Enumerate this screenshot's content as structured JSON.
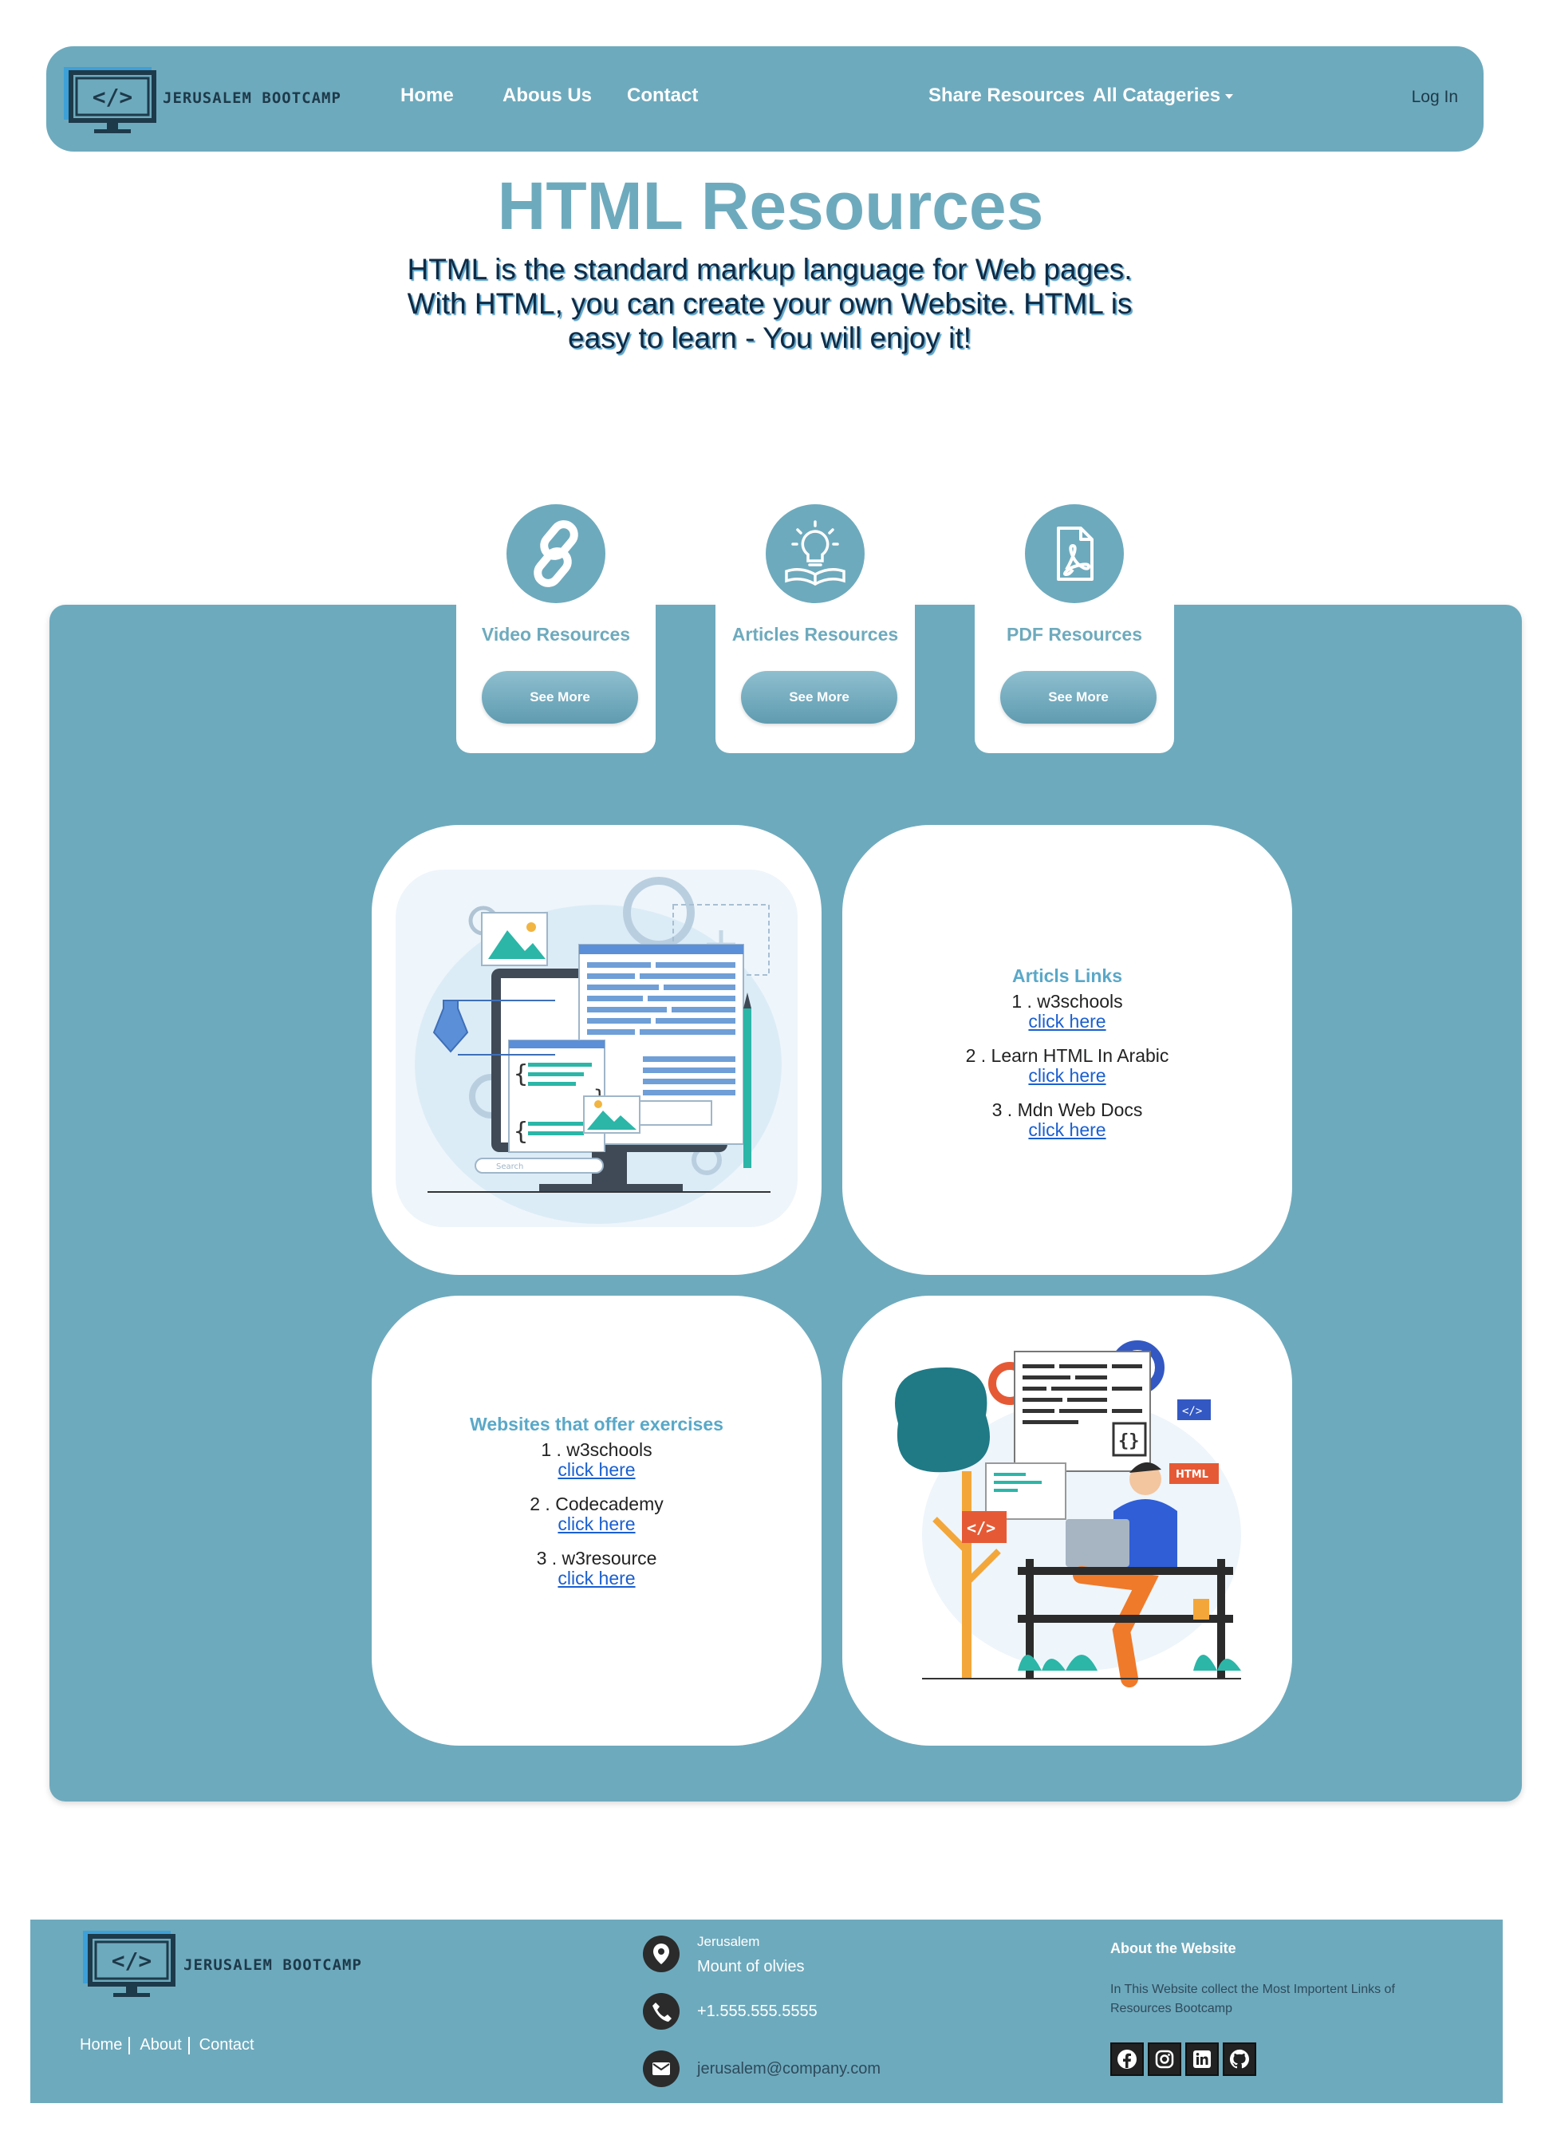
{
  "nav": {
    "brand": "JERUSALEM BOOTCAMP",
    "links": [
      "Home",
      "Abous Us",
      "Contact"
    ],
    "share": "Share Resources",
    "categories": "All Catageries",
    "login": "Log In"
  },
  "hero": {
    "title": "HTML Resources",
    "subtitle": "HTML is the standard markup language for Web pages. With HTML, you can create your own Website. HTML is easy to learn - You will enjoy it!"
  },
  "categories": [
    {
      "title": "Video Resources",
      "button": "See More",
      "icon": "link-icon"
    },
    {
      "title": "Articles Resources",
      "button": "See More",
      "icon": "lightbulb-book-icon"
    },
    {
      "title": "PDF Resources",
      "button": "See More",
      "icon": "pdf-file-icon"
    }
  ],
  "articles": {
    "title": "Articls Links",
    "items": [
      {
        "label": "1 . w3schools",
        "link": "click here"
      },
      {
        "label": "2 . Learn HTML In Arabic",
        "link": "click here"
      },
      {
        "label": "3 . Mdn Web Docs",
        "link": "click here"
      }
    ]
  },
  "exercises": {
    "title": "Websites that offer exercises",
    "items": [
      {
        "label": "1 . w3schools",
        "link": "click here"
      },
      {
        "label": "2 . Codecademy",
        "link": "click here"
      },
      {
        "label": "3 . w3resource",
        "link": "click here"
      }
    ]
  },
  "footer": {
    "brand": "JERUSALEM BOOTCAMP",
    "nav": [
      "Home",
      "About",
      "Contact"
    ],
    "city": "Jerusalem",
    "address": "Mount of olvies",
    "phone": "+1.555.555.5555",
    "email": "jerusalem@company.com",
    "about_title": "About the Website",
    "about_text": "In This Website collect the Most Importent Links of Resources Bootcamp",
    "illustration_search": "Search"
  },
  "colors": {
    "accent": "#6eaabd",
    "link": "#1a5fd0",
    "dark": "#0f2a44"
  }
}
